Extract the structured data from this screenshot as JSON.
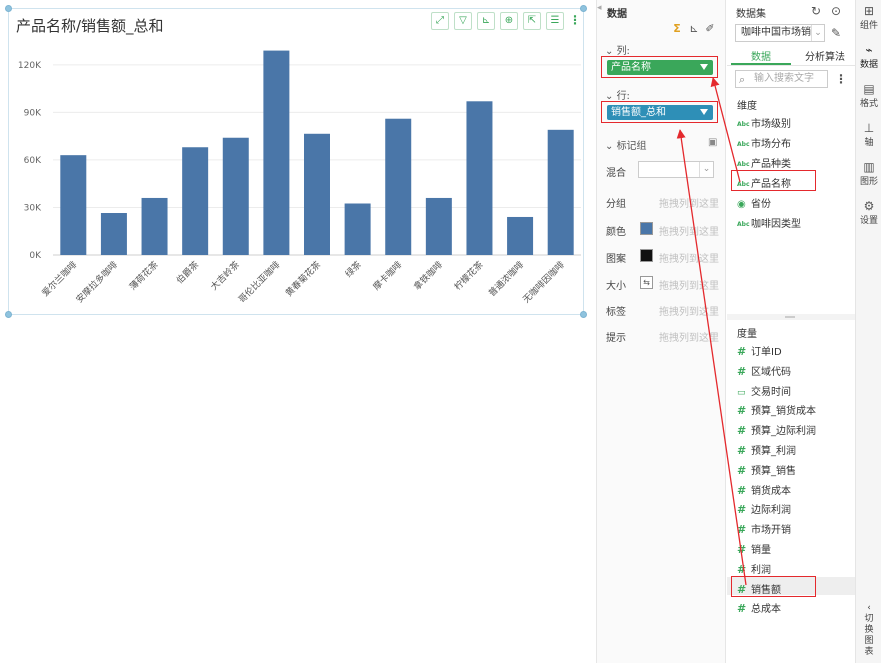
{
  "chart": {
    "title": "产品名称/销售额_总和",
    "toolbar": [
      "expand-icon",
      "filter-icon",
      "drill-icon",
      "zoom-icon",
      "export-icon",
      "list-icon"
    ]
  },
  "chart_data": {
    "type": "bar",
    "title": "产品名称/销售额_总和",
    "categories": [
      "爱尔兰咖啡",
      "安摩拉多咖啡",
      "薄荷花茶",
      "伯爵茶",
      "大吉岭茶",
      "哥伦比亚咖啡",
      "黄春菊花茶",
      "绿茶",
      "摩卡咖啡",
      "拿铁咖啡",
      "柠檬花茶",
      "普通浓咖啡",
      "无咖啡因咖啡"
    ],
    "values": [
      63000,
      26500,
      36000,
      68000,
      74000,
      129000,
      76500,
      32500,
      86000,
      36000,
      97000,
      24000,
      79000
    ],
    "ylim": [
      0,
      130000
    ],
    "yticks": [
      "0K",
      "30K",
      "60K",
      "90K",
      "120K"
    ],
    "ytick_values": [
      0,
      30000,
      60000,
      90000,
      120000
    ],
    "color": "#4a76a8",
    "grid": true
  },
  "config": {
    "title": "数据",
    "columns_label": "列:",
    "columns_pill": "产品名称",
    "columns_pill_color": "#3aa75a",
    "rows_label": "行:",
    "rows_pill": "销售额_总和",
    "rows_pill_color": "#2e8fb7",
    "marks_label": "标记组",
    "props": [
      {
        "label": "混合",
        "drop": ""
      },
      {
        "label": "分组",
        "drop": "拖拽列到这里"
      },
      {
        "label": "颜色",
        "drop": "拖拽列到这里"
      },
      {
        "label": "图案",
        "drop": "拖拽列到这里"
      },
      {
        "label": "大小",
        "drop": "拖拽列到这里"
      },
      {
        "label": "标签",
        "drop": "拖拽列到这里"
      },
      {
        "label": "提示",
        "drop": "拖拽列到这里"
      }
    ],
    "color_swatch": "#4a76a8",
    "pattern_swatch": "#111111"
  },
  "dataset": {
    "title": "数据集",
    "selected": "咖啡中国市场销",
    "tabs": [
      "数据",
      "分析算法"
    ],
    "search_placeholder": "输入搜索文字",
    "dimensions_title": "维度",
    "dimensions": [
      {
        "icon": "Abc",
        "label": "市场级别"
      },
      {
        "icon": "Abc",
        "label": "市场分布"
      },
      {
        "icon": "Abc",
        "label": "产品种类"
      },
      {
        "icon": "Abc",
        "label": "产品名称"
      },
      {
        "icon": "globe",
        "label": "省份"
      },
      {
        "icon": "Abc",
        "label": "咖啡因类型"
      }
    ],
    "measures_title": "度量",
    "measures": [
      {
        "icon": "#",
        "label": "订单ID"
      },
      {
        "icon": "#",
        "label": "区域代码"
      },
      {
        "icon": "date",
        "label": "交易时间"
      },
      {
        "icon": "#",
        "label": "预算_销货成本"
      },
      {
        "icon": "#",
        "label": "预算_边际利润"
      },
      {
        "icon": "#",
        "label": "预算_利润"
      },
      {
        "icon": "#",
        "label": "预算_销售"
      },
      {
        "icon": "#",
        "label": "销货成本"
      },
      {
        "icon": "#",
        "label": "边际利润"
      },
      {
        "icon": "#",
        "label": "市场开销"
      },
      {
        "icon": "#",
        "label": "销量"
      },
      {
        "icon": "#",
        "label": "利润"
      },
      {
        "icon": "#",
        "label": "销售额"
      },
      {
        "icon": "#",
        "label": "总成本"
      }
    ]
  },
  "strip": [
    {
      "glyph": "⊞",
      "label": "组件"
    },
    {
      "glyph": "⌁",
      "label": "数据"
    },
    {
      "glyph": "▤",
      "label": "格式"
    },
    {
      "glyph": "⊥",
      "label": "轴"
    },
    {
      "glyph": "▥",
      "label": "图形"
    },
    {
      "glyph": "⚙",
      "label": "设置"
    }
  ],
  "strip_switch": [
    "切",
    "换",
    "图",
    "表"
  ],
  "annotation_color": "#e4292d"
}
